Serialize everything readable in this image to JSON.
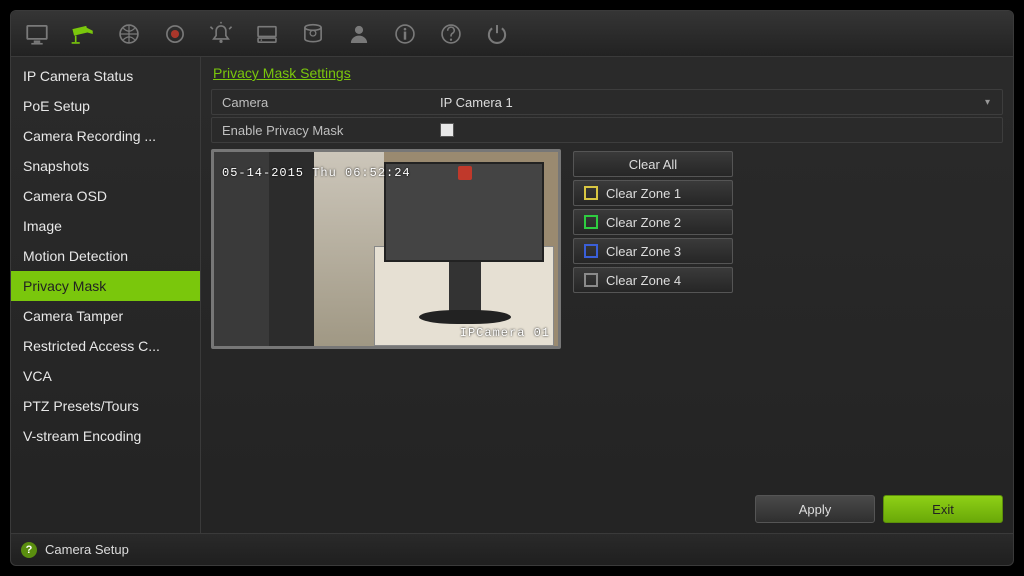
{
  "toolbar_icons": [
    {
      "name": "live-view-icon"
    },
    {
      "name": "camera-icon"
    },
    {
      "name": "network-icon"
    },
    {
      "name": "record-icon"
    },
    {
      "name": "alarm-icon"
    },
    {
      "name": "device-icon"
    },
    {
      "name": "storage-icon"
    },
    {
      "name": "user-icon"
    },
    {
      "name": "info-icon"
    },
    {
      "name": "help-icon"
    },
    {
      "name": "power-icon"
    }
  ],
  "toolbar_active_index": 1,
  "sidebar": {
    "items": [
      "IP Camera Status",
      "PoE Setup",
      "Camera Recording ...",
      "Snapshots",
      "Camera OSD",
      "Image",
      "Motion Detection",
      "Privacy Mask",
      "Camera Tamper",
      "Restricted Access C...",
      "VCA",
      "PTZ Presets/Tours",
      "V-stream Encoding"
    ],
    "active_index": 7
  },
  "panel": {
    "title": "Privacy Mask Settings",
    "camera_label": "Camera",
    "camera_value": "IP Camera 1",
    "enable_label": "Enable Privacy Mask",
    "enable_checked": false,
    "preview": {
      "timestamp": "05-14-2015 Thu 06:52:24",
      "camera_tag": "IPCamera 01"
    },
    "zone_buttons": {
      "clear_all": "Clear All",
      "zones": [
        {
          "label": "Clear Zone 1",
          "color": "#d8c642"
        },
        {
          "label": "Clear Zone 2",
          "color": "#2ecc40"
        },
        {
          "label": "Clear Zone 3",
          "color": "#3a5fd8"
        },
        {
          "label": "Clear Zone 4",
          "color": "#8a8a8a"
        }
      ]
    }
  },
  "footer": {
    "apply": "Apply",
    "exit": "Exit"
  },
  "bottombar": {
    "breadcrumb": "Camera Setup"
  }
}
